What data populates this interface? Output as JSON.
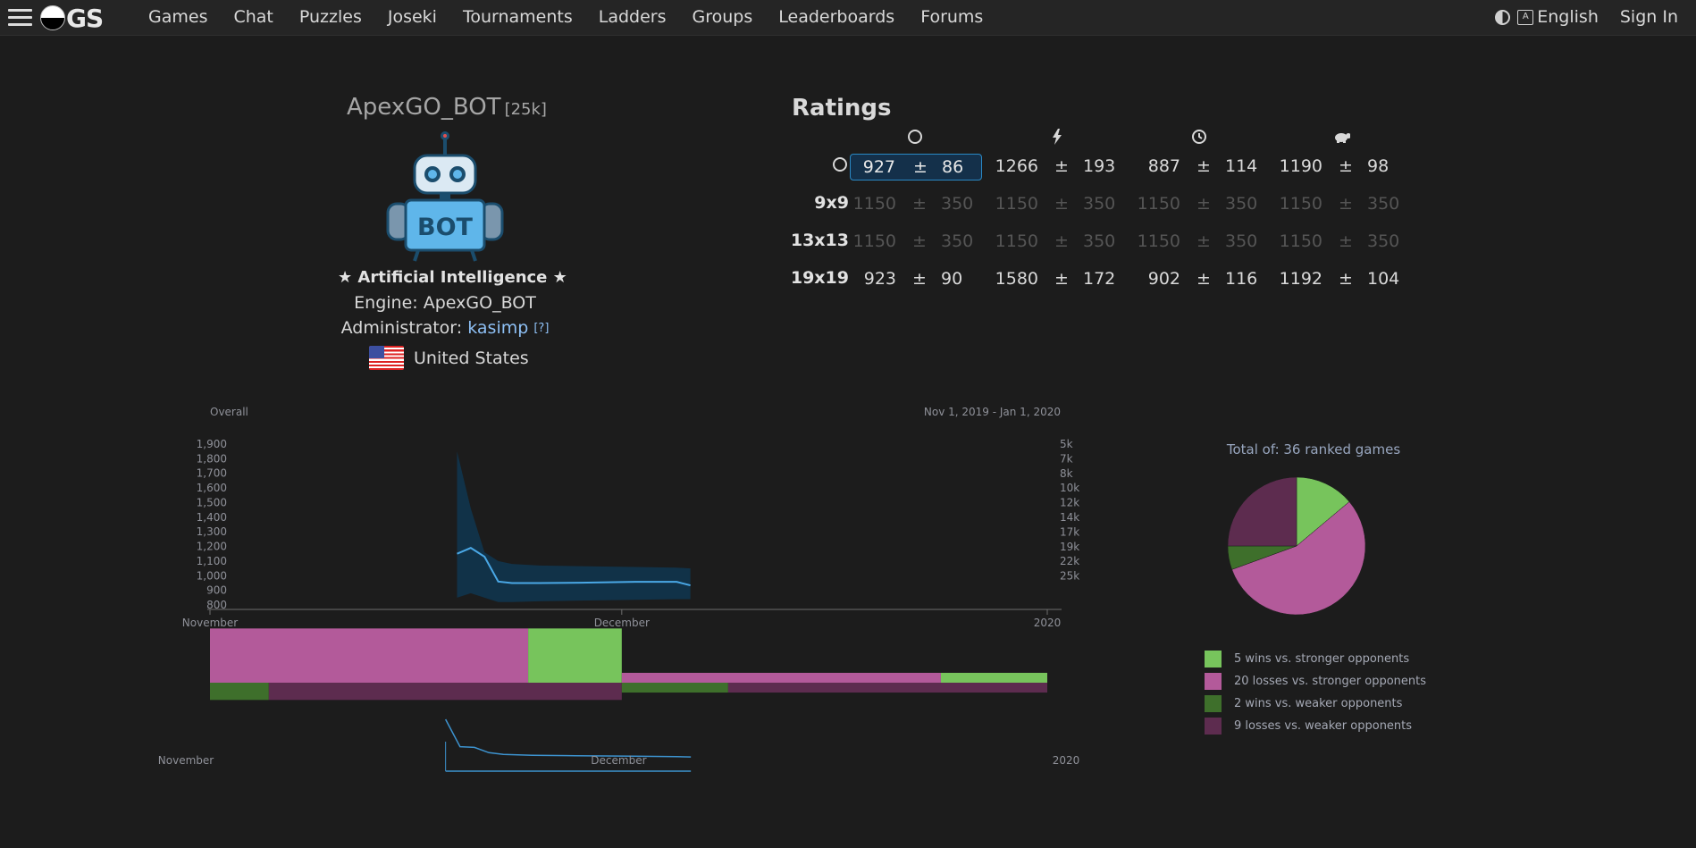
{
  "nav": {
    "logo_text": "GS",
    "links": [
      "Games",
      "Chat",
      "Puzzles",
      "Joseki",
      "Tournaments",
      "Ladders",
      "Groups",
      "Leaderboards",
      "Forums"
    ],
    "language": "English",
    "sign_in": "Sign In",
    "language_icon_glyph": "A"
  },
  "profile": {
    "username": "ApexGO_BOT",
    "rank": "[25k]",
    "avatar_text": "BOT",
    "ai_label": "Artificial Intelligence",
    "engine_label": "Engine:",
    "engine": "ApexGO_BOT",
    "admin_label": "Administrator:",
    "admin": "kasimp",
    "admin_help": "[?]",
    "country": "United States"
  },
  "ratings": {
    "title": "Ratings",
    "columns": [
      "overall-icon",
      "blitz-icon",
      "live-icon",
      "correspondence-icon"
    ],
    "rows": [
      {
        "label": "",
        "cells": [
          {
            "v": "927",
            "pm": "±",
            "d": "86"
          },
          {
            "v": "1266",
            "pm": "±",
            "d": "193"
          },
          {
            "v": "887",
            "pm": "±",
            "d": "114"
          },
          {
            "v": "1190",
            "pm": "±",
            "d": "98"
          }
        ]
      },
      {
        "label": "9x9",
        "cells": [
          {
            "v": "1150",
            "pm": "±",
            "d": "350"
          },
          {
            "v": "1150",
            "pm": "±",
            "d": "350"
          },
          {
            "v": "1150",
            "pm": "±",
            "d": "350"
          },
          {
            "v": "1150",
            "pm": "±",
            "d": "350"
          }
        ]
      },
      {
        "label": "13x13",
        "cells": [
          {
            "v": "1150",
            "pm": "±",
            "d": "350"
          },
          {
            "v": "1150",
            "pm": "±",
            "d": "350"
          },
          {
            "v": "1150",
            "pm": "±",
            "d": "350"
          },
          {
            "v": "1150",
            "pm": "±",
            "d": "350"
          }
        ]
      },
      {
        "label": "19x19",
        "cells": [
          {
            "v": "923",
            "pm": "±",
            "d": "90"
          },
          {
            "v": "1580",
            "pm": "±",
            "d": "172"
          },
          {
            "v": "902",
            "pm": "±",
            "d": "116"
          },
          {
            "v": "1192",
            "pm": "±",
            "d": "104"
          }
        ]
      }
    ]
  },
  "history": {
    "title": "Overall",
    "date_range": "Nov 1, 2019 - Jan 1, 2020",
    "nav_labels": [
      "November",
      "December",
      "2020"
    ]
  },
  "pie": {
    "title": "Total of: 36 ranked games",
    "legend": [
      {
        "label": "5 wins vs. stronger opponents",
        "color": "#77c45c"
      },
      {
        "label": "20 losses vs. stronger opponents",
        "color": "#b35a9a"
      },
      {
        "label": "2 wins vs. weaker opponents",
        "color": "#3e6f2b"
      },
      {
        "label": "9 losses vs. weaker opponents",
        "color": "#5d2c4f"
      }
    ]
  },
  "chart_data": [
    {
      "type": "area",
      "title": "Overall",
      "subtitle": "Nov 1, 2019 - Jan 1, 2020",
      "x_ticks": [
        "November",
        "December",
        "2020"
      ],
      "y_ticks": [
        1900,
        1800,
        1700,
        1600,
        1500,
        1400,
        1300,
        1200,
        1100,
        1000,
        900,
        800
      ],
      "y_ticks_labels": [
        "1,900",
        "1,800",
        "1,700",
        "1,600",
        "1,500",
        "1,400",
        "1,300",
        "1,200",
        "1,100",
        "1,000",
        "900",
        "800"
      ],
      "y_right_ticks": [
        "5k",
        "7k",
        "8k",
        "10k",
        "12k",
        "14k",
        "17k",
        "19k",
        "22k",
        "25k"
      ],
      "ylim": [
        800,
        1900
      ],
      "series": [
        {
          "x": [
            "2019-11-19",
            "2019-11-20",
            "2019-11-21",
            "2019-11-22",
            "2019-11-23",
            "2019-11-25",
            "2019-11-28",
            "2019-12-02",
            "2019-12-05",
            "2019-12-06"
          ],
          "y": [
            1150,
            1190,
            1130,
            960,
            950,
            950,
            952,
            958,
            958,
            934
          ],
          "upper": [
            1850,
            1460,
            1160,
            1100,
            1080,
            1070,
            1065,
            1060,
            1055,
            1050
          ],
          "lower": [
            850,
            880,
            850,
            820,
            820,
            825,
            830,
            835,
            840,
            840
          ]
        }
      ]
    },
    {
      "type": "bar",
      "title": "",
      "categories": [
        "November",
        "December"
      ],
      "series": [
        {
          "name": "",
          "values": [
            5,
            1
          ],
          "color": "#77c45c"
        },
        {
          "name": "",
          "values": [
            17,
            3
          ],
          "color": "#b35a9a"
        },
        {
          "name": "",
          "values": [
            1,
            1
          ],
          "color": "#3e6f2b"
        },
        {
          "name": "",
          "values": [
            6,
            3
          ],
          "color": "#5d2c4f"
        }
      ]
    },
    {
      "type": "pie",
      "title": "Total of: 36 ranked games",
      "categories": [
        "5 wins vs. stronger opponents",
        "20 losses vs. stronger opponents",
        "2 wins vs. weaker opponents",
        "9 losses vs. weaker opponents"
      ],
      "values": [
        5,
        20,
        2,
        9
      ],
      "colors": [
        "#77c45c",
        "#b35a9a",
        "#3e6f2b",
        "#5d2c4f"
      ]
    }
  ]
}
